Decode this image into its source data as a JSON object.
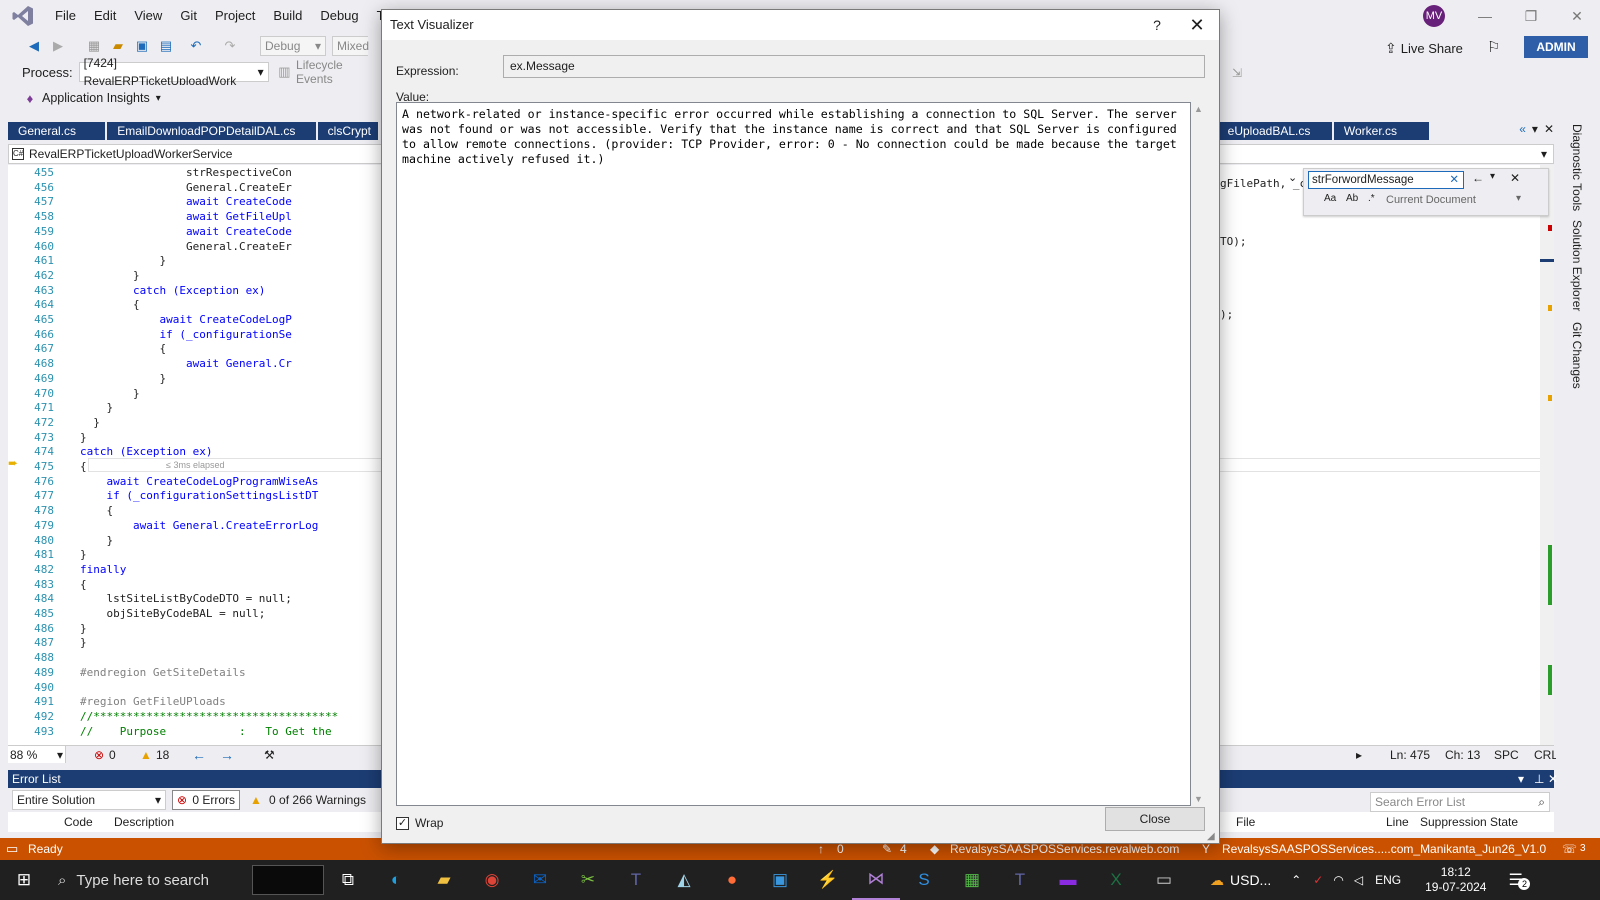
{
  "menu": {
    "items": [
      "File",
      "Edit",
      "View",
      "Git",
      "Project",
      "Build",
      "Debug",
      "Test"
    ]
  },
  "avatar": {
    "initials": "MV"
  },
  "toolbar": {
    "config_value": "Debug",
    "platform_value": "Mixed",
    "live_share_label": "Live Share",
    "admin_label": "ADMIN",
    "process_label": "Process:",
    "process_value": "[7424] RevalERPTicketUploadWork",
    "lifecycle_label": "Lifecycle Events",
    "app_insights_label": "Application Insights"
  },
  "tabs": {
    "items": [
      "General.cs",
      "EmailDownloadPOPDetailDAL.cs",
      "clsCrypt",
      "eUploadBAL.cs",
      "Worker.cs"
    ]
  },
  "navbar": {
    "project": "RevalERPTicketUploadWorkerService"
  },
  "editor": {
    "lines": [
      {
        "n": "455",
        "code": "                strRespectiveCon"
      },
      {
        "n": "456",
        "code": "                General.CreateEr"
      },
      {
        "n": "457",
        "code": "                await CreateCode"
      },
      {
        "n": "458",
        "code": "                await GetFileUpl"
      },
      {
        "n": "459",
        "code": "                await CreateCode"
      },
      {
        "n": "460",
        "code": "                General.CreateEr"
      },
      {
        "n": "461",
        "code": "            }"
      },
      {
        "n": "462",
        "code": "        }"
      },
      {
        "n": "463",
        "code": "        catch (Exception ex)"
      },
      {
        "n": "464",
        "code": "        {"
      },
      {
        "n": "465",
        "code": "            await CreateCodeLogP"
      },
      {
        "n": "466",
        "code": "            if (_configurationSe"
      },
      {
        "n": "467",
        "code": "            {"
      },
      {
        "n": "468",
        "code": "                await General.Cr"
      },
      {
        "n": "469",
        "code": "            }"
      },
      {
        "n": "470",
        "code": "        }"
      },
      {
        "n": "471",
        "code": "    }"
      },
      {
        "n": "472",
        "code": "  }"
      },
      {
        "n": "473",
        "code": "}"
      },
      {
        "n": "474",
        "code": "catch (Exception ex)"
      },
      {
        "n": "475",
        "code": "{"
      },
      {
        "n": "476",
        "code": "    await CreateCodeLogProgramWiseAs"
      },
      {
        "n": "477",
        "code": "    if (_configurationSettingsListDT"
      },
      {
        "n": "478",
        "code": "    {"
      },
      {
        "n": "479",
        "code": "        await General.CreateErrorLog"
      },
      {
        "n": "480",
        "code": "    }"
      },
      {
        "n": "481",
        "code": "}"
      },
      {
        "n": "482",
        "code": "finally"
      },
      {
        "n": "483",
        "code": "{"
      },
      {
        "n": "484",
        "code": "    lstSiteListByCodeDTO = null;"
      },
      {
        "n": "485",
        "code": "    objSiteByCodeBAL = null;"
      },
      {
        "n": "486",
        "code": "}"
      },
      {
        "n": "487",
        "code": "}"
      },
      {
        "n": "488",
        "code": ""
      },
      {
        "n": "489",
        "code": "#endregion GetSiteDetails"
      },
      {
        "n": "490",
        "code": ""
      },
      {
        "n": "491",
        "code": "#region GetFileUPloads"
      },
      {
        "n": "492",
        "code": "//*************************************"
      },
      {
        "n": "493",
        "code": "//    Purpose           :   To Get the"
      }
    ],
    "elapsed_hint": "≤ 3ms elapsed",
    "right_fragment_1": "gFilePath, _cc",
    "right_fragment_2": "TO);",
    "right_fragment_3": ");"
  },
  "editor_status": {
    "zoom": "88 %",
    "errors": "0",
    "warnings": "18",
    "ln": "Ln: 475",
    "ch": "Ch: 13",
    "spc": "SPC",
    "crlf": "CRLF"
  },
  "find": {
    "value": "strForwordMessage",
    "scope": "Current Document"
  },
  "sidebar_tabs": [
    "Diagnostic Tools",
    "Solution Explorer",
    "Git Changes"
  ],
  "error_list": {
    "title": "Error List",
    "scope": "Entire Solution",
    "errors_label": "0 Errors",
    "warnings_label": "0 of 266 Warnings",
    "search_placeholder": "Search Error List",
    "col_code": "Code",
    "col_description": "Description",
    "col_file": "File",
    "col_line": "Line",
    "col_suppression": "Suppression State"
  },
  "statusbar": {
    "ready": "Ready",
    "up_count": "0",
    "pencil_count": "4",
    "repo": "RevalsysSAASPOSServices.revalweb.com",
    "branch": "RevalsysSAASPOSServices.....com_Manikanta_Jun26_V1.0",
    "notif_count": "3"
  },
  "taskbar": {
    "search_placeholder": "Type here to search",
    "weather": "USD...",
    "lang": "ENG",
    "time": "18:12",
    "date": "19-07-2024",
    "notif_count": "2"
  },
  "dialog": {
    "title": "Text Visualizer",
    "help": "?",
    "expression_label": "Expression:",
    "expression_value": "ex.Message",
    "value_label": "Value:",
    "value_text": "A network-related or instance-specific error occurred while establishing a connection to SQL Server. The server was not found or was not accessible. Verify that the instance name is correct and that SQL Server is configured to allow remote connections. (provider: TCP Provider, error: 0 - No connection could be made because the target machine actively refused it.)",
    "wrap_label": "Wrap",
    "wrap_checked": true,
    "close_label": "Close"
  }
}
